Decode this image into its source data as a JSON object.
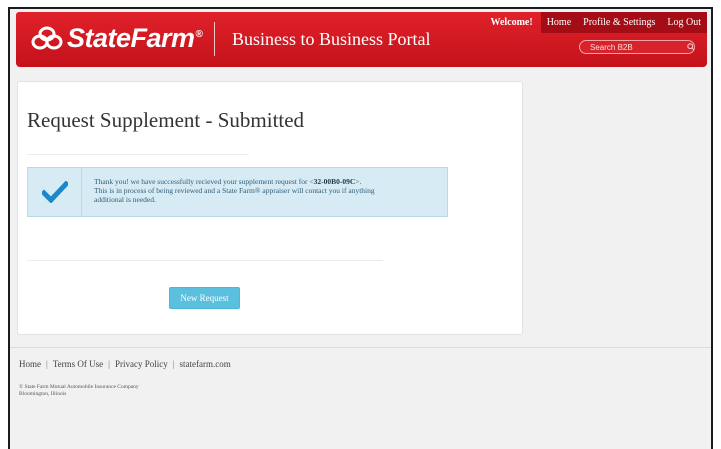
{
  "header": {
    "brand": "StateFarm",
    "registered_mark": "®",
    "portal_title": "Business to Business Portal",
    "nav": {
      "welcome": "Welcome!",
      "home": "Home",
      "profile_settings": "Profile & Settings",
      "log_out": "Log Out"
    },
    "search": {
      "placeholder": "Search B2B"
    }
  },
  "main": {
    "title": "Request Supplement - Submitted",
    "alert": {
      "line1_prefix": "Thank you! we have successfully recieved your supplement request for <",
      "request_id": "32-00B0-09C",
      "line1_suffix": ">.",
      "line2": "This is in process of being reviewed and a State Farm® appraiser will contact you if anything",
      "line3": "additional is needed."
    },
    "new_request_button": "New Request"
  },
  "footer": {
    "links": [
      "Home",
      "Terms Of Use",
      "Privacy Policy",
      "statefarm.com"
    ],
    "separator": "|",
    "copyright_line1": "© State Farm Mutual Automobile Insurance Company",
    "copyright_line2": "Bloomington, Illinois"
  },
  "colors": {
    "brand_red": "#d2161f",
    "nav_dark_red": "#a50d16",
    "alert_bg": "#d7ebf5",
    "button_blue": "#5bc0de",
    "check_blue": "#1e87c8"
  }
}
